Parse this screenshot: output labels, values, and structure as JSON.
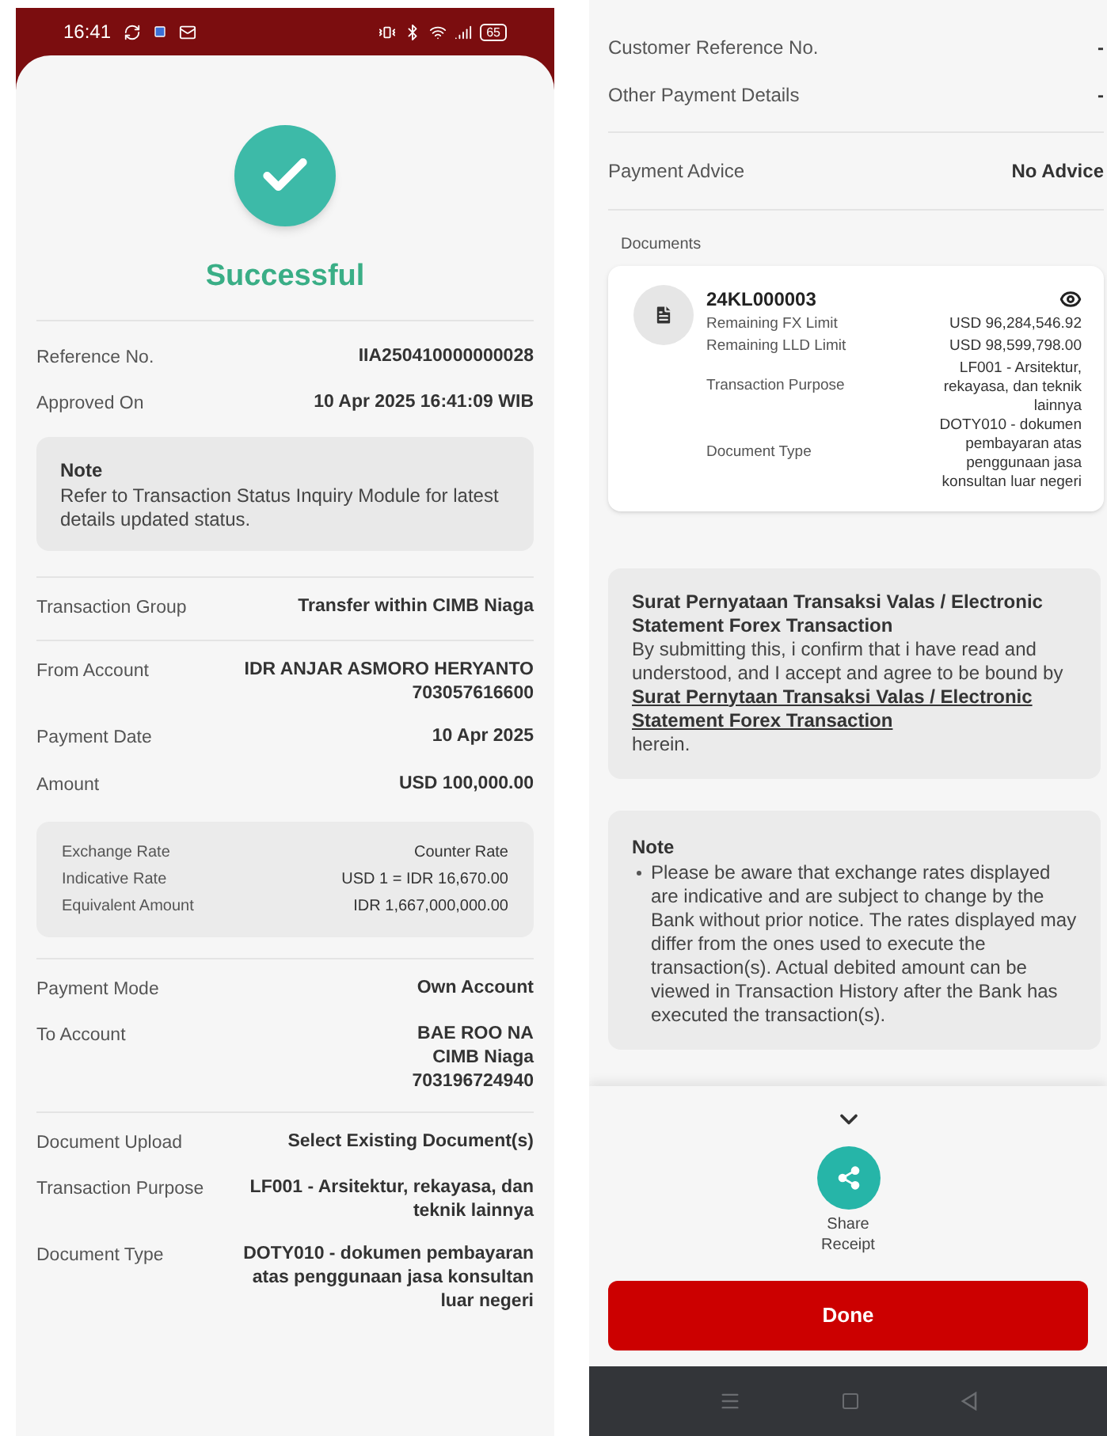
{
  "left": {
    "status_bar": {
      "time": "16:41",
      "battery": "65"
    },
    "title": "Successful",
    "summary": [
      {
        "label": "Reference No.",
        "value": [
          "IIA250410000000028"
        ]
      },
      {
        "label": "Approved On",
        "value": [
          "10 Apr 2025 16:41:09 WIB"
        ]
      }
    ],
    "note": {
      "title": "Note",
      "text": "Refer to Transaction Status Inquiry Module for latest details updated status."
    },
    "sections": [
      [
        {
          "kind": "field",
          "label": "Transaction Group",
          "value": [
            "Transfer within CIMB Niaga"
          ]
        }
      ],
      [
        {
          "kind": "field",
          "label": "From Account",
          "value": [
            "IDR ANJAR ASMORO HERYANTO",
            "703057616600"
          ]
        },
        {
          "kind": "field",
          "label": "Payment Date",
          "value": [
            "10 Apr 2025"
          ]
        },
        {
          "kind": "field",
          "label": "Amount",
          "value": [
            "USD 100,000.00"
          ]
        },
        {
          "kind": "rates",
          "rows": [
            {
              "label": "Exchange Rate",
              "value": "Counter Rate"
            },
            {
              "label": "Indicative Rate",
              "value": "USD 1 = IDR 16,670.00"
            },
            {
              "label": "Equivalent Amount",
              "value": "IDR 1,667,000,000.00"
            }
          ]
        }
      ],
      [
        {
          "kind": "field",
          "label": "Payment Mode",
          "value": [
            "Own Account"
          ]
        },
        {
          "kind": "field",
          "label": "To Account",
          "value": [
            "BAE ROO NA",
            "CIMB Niaga",
            "703196724940"
          ]
        }
      ],
      [
        {
          "kind": "field",
          "label": "Document Upload",
          "value": [
            "Select Existing Document(s)"
          ]
        },
        {
          "kind": "field",
          "label": "Transaction Purpose",
          "value": [
            "LF001 - Arsitektur, rekayasa, dan teknik lainnya"
          ]
        },
        {
          "kind": "field",
          "label": "Document Type",
          "value": [
            "DOTY010 - dokumen pembayaran atas penggunaan jasa konsultan luar negeri"
          ]
        }
      ]
    ]
  },
  "right": {
    "sections": [
      [
        {
          "label": "Customer Reference No.",
          "value": "-"
        },
        {
          "label": "Other Payment Details",
          "value": "-"
        }
      ],
      [
        {
          "label": "Payment Advice",
          "value": "No Advice"
        }
      ]
    ],
    "documents": {
      "label": "Documents",
      "items": [
        {
          "number": "24KL000003",
          "details": [
            {
              "label": "Remaining FX Limit",
              "value": "USD 96,284,546.92"
            },
            {
              "label": "Remaining LLD Limit",
              "value": "USD 98,599,798.00"
            },
            {
              "label": "Transaction Purpose",
              "value": "LF001 - Arsitektur, rekayasa, dan teknik lainnya"
            },
            {
              "label": "Document Type",
              "value": "DOTY010 - dokumen pembayaran atas penggunaan jasa konsultan luar negeri"
            }
          ]
        }
      ]
    },
    "statement": {
      "title": "Surat Pernyataan Transaksi Valas / Electronic Statement Forex Transaction",
      "text_before": "By submitting this, i confirm that i have read and understood, and I accept and agree to be bound by",
      "link": "Surat Pernytaan Transaksi Valas / Electronic Statement Forex Transaction",
      "text_after": "herein."
    },
    "note": {
      "title": "Note",
      "bullets": [
        "Please be aware that exchange rates displayed are indicative and are subject to change by the Bank without prior notice. The rates displayed may differ from the ones used to execute the transaction(s). Actual debited amount can be viewed in Transaction History after the Bank has executed the transaction(s)."
      ]
    },
    "share": {
      "label": "Share Receipt"
    },
    "done": "Done"
  }
}
